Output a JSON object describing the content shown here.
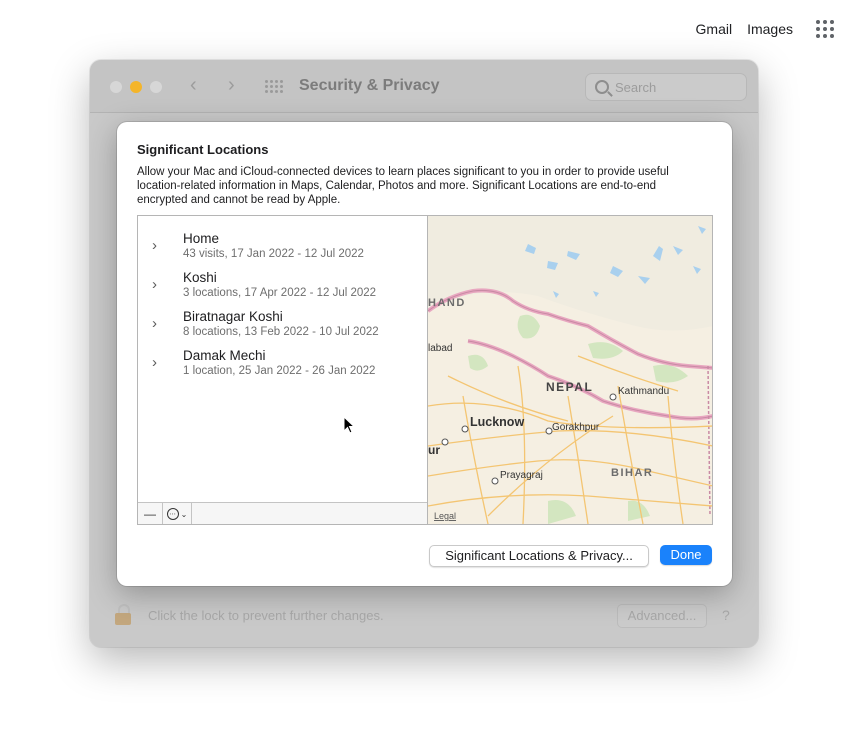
{
  "google_header": {
    "gmail": "Gmail",
    "images": "Images"
  },
  "window": {
    "title": "Security & Privacy",
    "search_placeholder": "Search",
    "lock_text": "Click the lock to prevent further changes.",
    "advanced_button": "Advanced...",
    "help_button": "?"
  },
  "sheet": {
    "title": "Significant Locations",
    "description": "Allow your Mac and iCloud-connected devices to learn places significant to you in order to provide useful location-related information in Maps, Calendar, Photos and more. Significant Locations are end-to-end encrypted and cannot be read by Apple.",
    "locations": [
      {
        "name": "Home",
        "detail": "43 visits, 17 Jan 2022 - 12 Jul 2022"
      },
      {
        "name": "Koshi",
        "detail": "3 locations, 17 Apr 2022 - 12 Jul 2022"
      },
      {
        "name": "Biratnagar Koshi",
        "detail": "8 locations, 13 Feb 2022 - 10 Jul 2022"
      },
      {
        "name": "Damak Mechi",
        "detail": "1 location, 25 Jan 2022 - 26 Jan 2022"
      }
    ],
    "map_labels": {
      "region_top": "HAND",
      "city_left": "labad",
      "country": "NEPAL",
      "capital": "Kathmandu",
      "city1": "Lucknow",
      "city2": "Gorakhpur",
      "city3": "ur",
      "city4": "Prayagraj",
      "state": "BIHAR",
      "legal": "Legal"
    },
    "privacy_button": "Significant Locations & Privacy...",
    "done_button": "Done"
  }
}
